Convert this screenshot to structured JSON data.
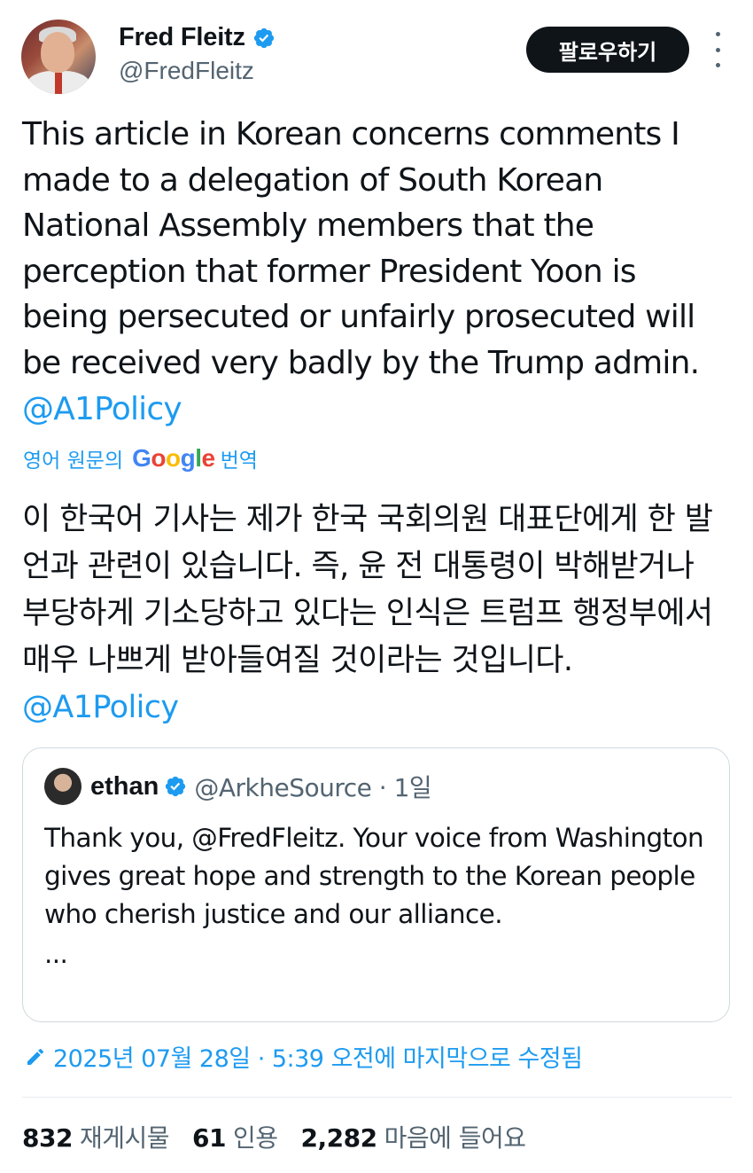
{
  "author": {
    "name": "Fred Fleitz",
    "handle": "@FredFleitz",
    "follow_label": "팔로우하기"
  },
  "tweet": {
    "text_en": "This article in Korean concerns comments I made to a delegation of South Korean National Assembly members that the perception that former President Yoon is being persecuted or unfairly prosecuted will be received very badly by the Trump admin. ",
    "mention_en": "@A1Policy",
    "translate_prefix": "영어 원문의",
    "translate_suffix": "번역",
    "google_letters": [
      "G",
      "o",
      "o",
      "g",
      "l",
      "e"
    ],
    "text_ko": "이 한국어 기사는 제가 한국 국회의원 대표단에게 한 발언과 관련이 있습니다. 즉, 윤 전 대통령이 박해받거나 부당하게 기소당하고 있다는 인식은 트럼프 행정부에서 매우 나쁘게 받아들여질 것이라는 것입니다. ",
    "mention_ko": "@A1Policy"
  },
  "quoted": {
    "name": "ethan",
    "handle_time": "@ArkheSource · 1일",
    "text": "Thank you, @FredFleitz. Your voice from Washington gives great hope and strength to the Korean people who cherish justice and our alliance.",
    "ellipsis": "..."
  },
  "edited_text": "2025년 07월 28일 · 5:39 오전에 마지막으로 수정됨",
  "stats": {
    "reposts_num": "832",
    "reposts_label": "재게시물",
    "quotes_num": "61",
    "quotes_label": "인용",
    "likes_num": "2,282",
    "likes_label": "마음에 들어요"
  },
  "colors": {
    "link": "#1d9bf0",
    "verified": "#1d9bf0",
    "muted": "#536471"
  }
}
